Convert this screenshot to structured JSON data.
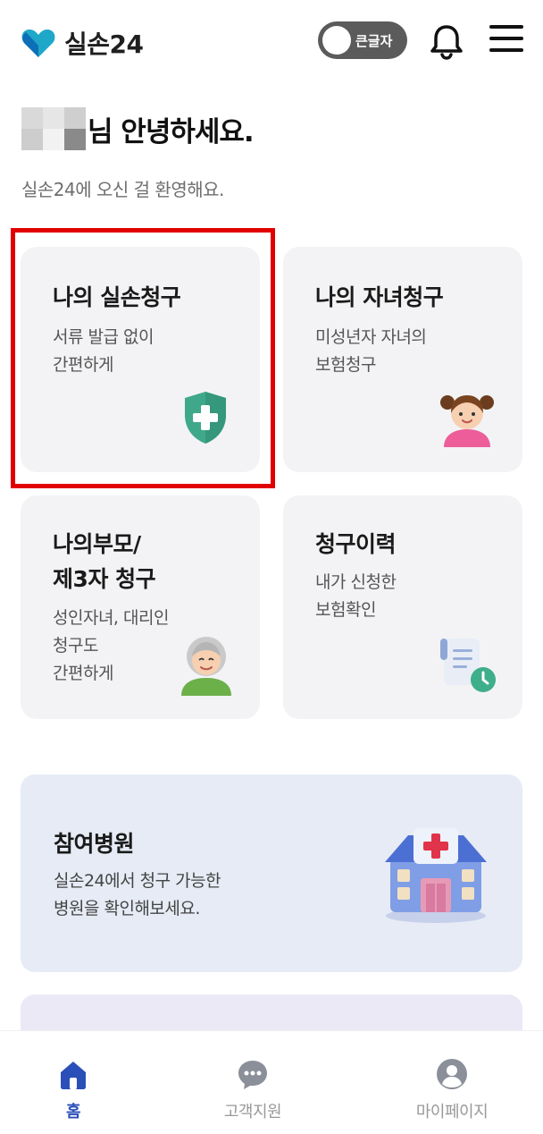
{
  "header": {
    "logo_text": "실손24",
    "large_text_toggle_label": "큰글자",
    "icons": [
      "heart-logo-icon",
      "bell-icon",
      "hamburger-menu-icon"
    ]
  },
  "greeting": {
    "name_suffix": "님 안녕하세요.",
    "welcome": "실손24에 오신 걸 환영해요."
  },
  "cards": [
    {
      "title": "나의 실손청구",
      "desc_line1": "서류 발급 없이",
      "desc_line2": "간편하게",
      "icon": "shield-plus-icon"
    },
    {
      "title": "나의 자녀청구",
      "desc_line1": "미성년자 자녀의",
      "desc_line2": "보험청구",
      "icon": "child-avatar-icon"
    },
    {
      "title_line1": "나의부모/",
      "title_line2": "제3자 청구",
      "desc_line1": "성인자녀, 대리인",
      "desc_line2": "청구도",
      "desc_line3": "간편하게",
      "icon": "grandmother-avatar-icon"
    },
    {
      "title": "청구이력",
      "desc_line1": "내가 신청한",
      "desc_line2": "보험확인",
      "icon": "document-clock-icon"
    }
  ],
  "banner": {
    "title": "참여병원",
    "desc_line1": "실손24에서 청구 가능한",
    "desc_line2": "병원을 확인해보세요.",
    "icon": "hospital-building-icon"
  },
  "tabbar": {
    "items": [
      {
        "label": "홈",
        "icon": "home-icon",
        "active": true
      },
      {
        "label": "고객지원",
        "icon": "chat-bubble-icon",
        "active": false
      },
      {
        "label": "마이페이지",
        "icon": "user-circle-icon",
        "active": false
      }
    ]
  },
  "colors": {
    "accent": "#2b4fb8",
    "highlight_border": "#e00000",
    "card_bg": "#f3f3f5",
    "banner_bg": "#e6ebf5",
    "shield": "#3fa88a"
  }
}
